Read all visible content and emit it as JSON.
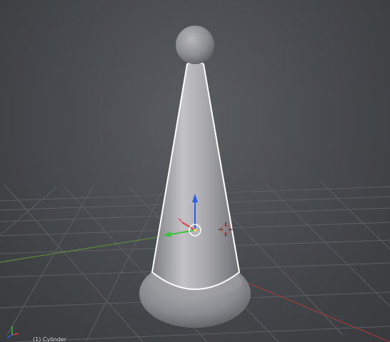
{
  "viewport": {
    "object_info": "(1) Cylinder",
    "colors": {
      "background": "#45484c",
      "grid": "#5b5d60",
      "x_axis": "#9a3b3b",
      "y_axis": "#5a8a3a",
      "mesh_light": "#c9c9cc",
      "mesh_dark": "#7d7e82",
      "selection_outline": "#ffffff",
      "manipulator_z": "#2c5de6",
      "manipulator_x": "#e23b3b",
      "manipulator_y": "#3fbf3f"
    },
    "icons": {
      "view_axis": "axis-gizmo-icon",
      "pivot": "3d-cursor-icon",
      "origin": "object-origin-icon"
    }
  }
}
